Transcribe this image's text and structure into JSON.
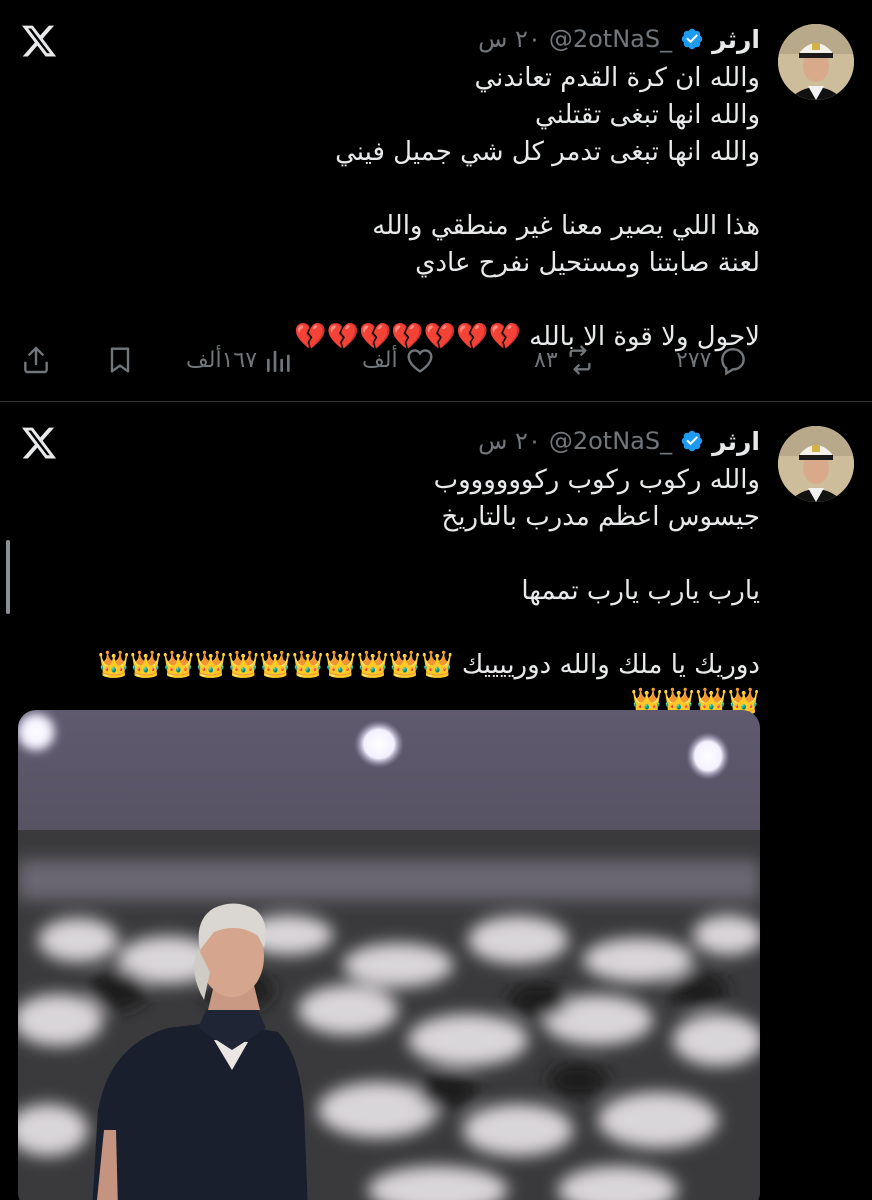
{
  "tweets": [
    {
      "author": "ارثر",
      "handle": "@2otNaS_",
      "time": "٢٠ س",
      "lines": [
        "والله ان كرة القدم تعاندني",
        "والله انها تبغى تقتلني",
        "والله انها تبغى تدمر كل شي جميل فيني",
        "",
        "هذا اللي يصير معنا غير منطقي والله",
        "لعنة صابتنا ومستحيل نفرح عادي",
        "",
        "لاحول ولا قوة الا بالله 💔💔💔💔💔💔💔"
      ],
      "stats": {
        "replies": "٢٧٧",
        "retweets": "٨٣",
        "likes": "ألف",
        "views": "١٦٧ألف"
      }
    },
    {
      "author": "ارثر",
      "handle": "@2otNaS_",
      "time": "٢٠ س",
      "lines": [
        "والله ركوب ركوب ركووووووب",
        "جيسوس اعظم مدرب بالتاريخ",
        "",
        "يارب يارب يارب تممها",
        "",
        "دوريك يا ملك والله دورييييك 👑👑👑👑👑👑👑👑👑👑👑",
        "👑👑👑👑"
      ]
    }
  ],
  "icons": {
    "logo": "x-logo-icon",
    "verified": "verified-badge-icon",
    "reply": "reply-icon",
    "retweet": "retweet-icon",
    "like": "heart-icon",
    "views": "views-icon",
    "bookmark": "bookmark-icon",
    "share": "share-icon"
  },
  "colors": {
    "background": "#000000",
    "text": "#e7e9ea",
    "muted": "#71767b",
    "verified": "#1d9bf0",
    "divider": "#2f3336"
  }
}
